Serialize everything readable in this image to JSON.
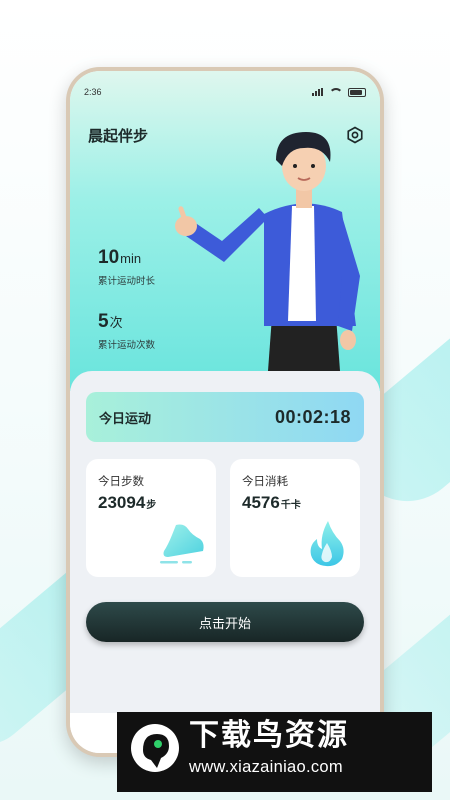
{
  "status_bar": {
    "time": "2:36"
  },
  "app": {
    "title": "晨起伴步"
  },
  "stats": {
    "duration": {
      "value": "10",
      "unit": "min",
      "label": "累计运动时长"
    },
    "count": {
      "value": "5",
      "unit": "次",
      "label": "累计运动次数"
    }
  },
  "today": {
    "label": "今日运动",
    "time": "00:02:18"
  },
  "steps": {
    "label": "今日步数",
    "value": "23094",
    "unit": "步"
  },
  "calories": {
    "label": "今日消耗",
    "value": "4576",
    "unit": "千卡"
  },
  "start_button": {
    "label": "点击开始"
  },
  "watermark": {
    "title": "下载鸟资源",
    "url": "www.xiazainiao.com"
  },
  "colors": {
    "accent": "#69e4dd",
    "button": "#1e3333",
    "flame": "#4fd8e8"
  }
}
